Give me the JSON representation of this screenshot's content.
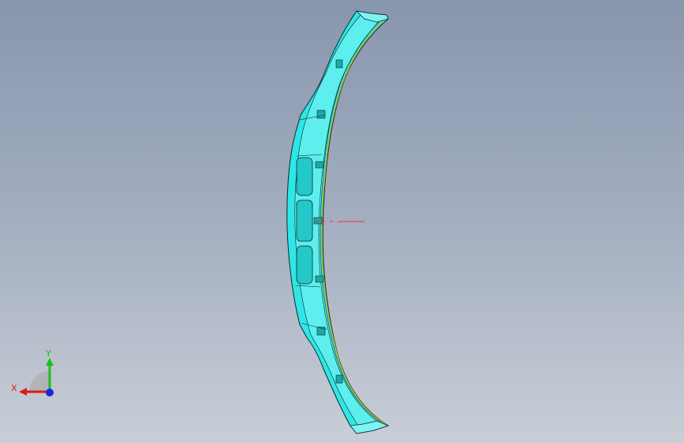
{
  "viewport": {
    "background_top": "#8896ad",
    "background_bottom": "#c9ced7"
  },
  "model": {
    "part_fill": "#2fe6e6",
    "part_fill_light": "#7ff2f2",
    "edge_color": "#0a2a2a",
    "inner_edge_color": "#c8b400"
  },
  "origin_marker": {
    "color": "#ff2a2a"
  },
  "triad": {
    "x_label": "X",
    "y_label": "Y",
    "x_color": "#e01818",
    "y_color": "#18c018",
    "z_color": "#1828e0",
    "plane_color": "#b0b0b0"
  }
}
